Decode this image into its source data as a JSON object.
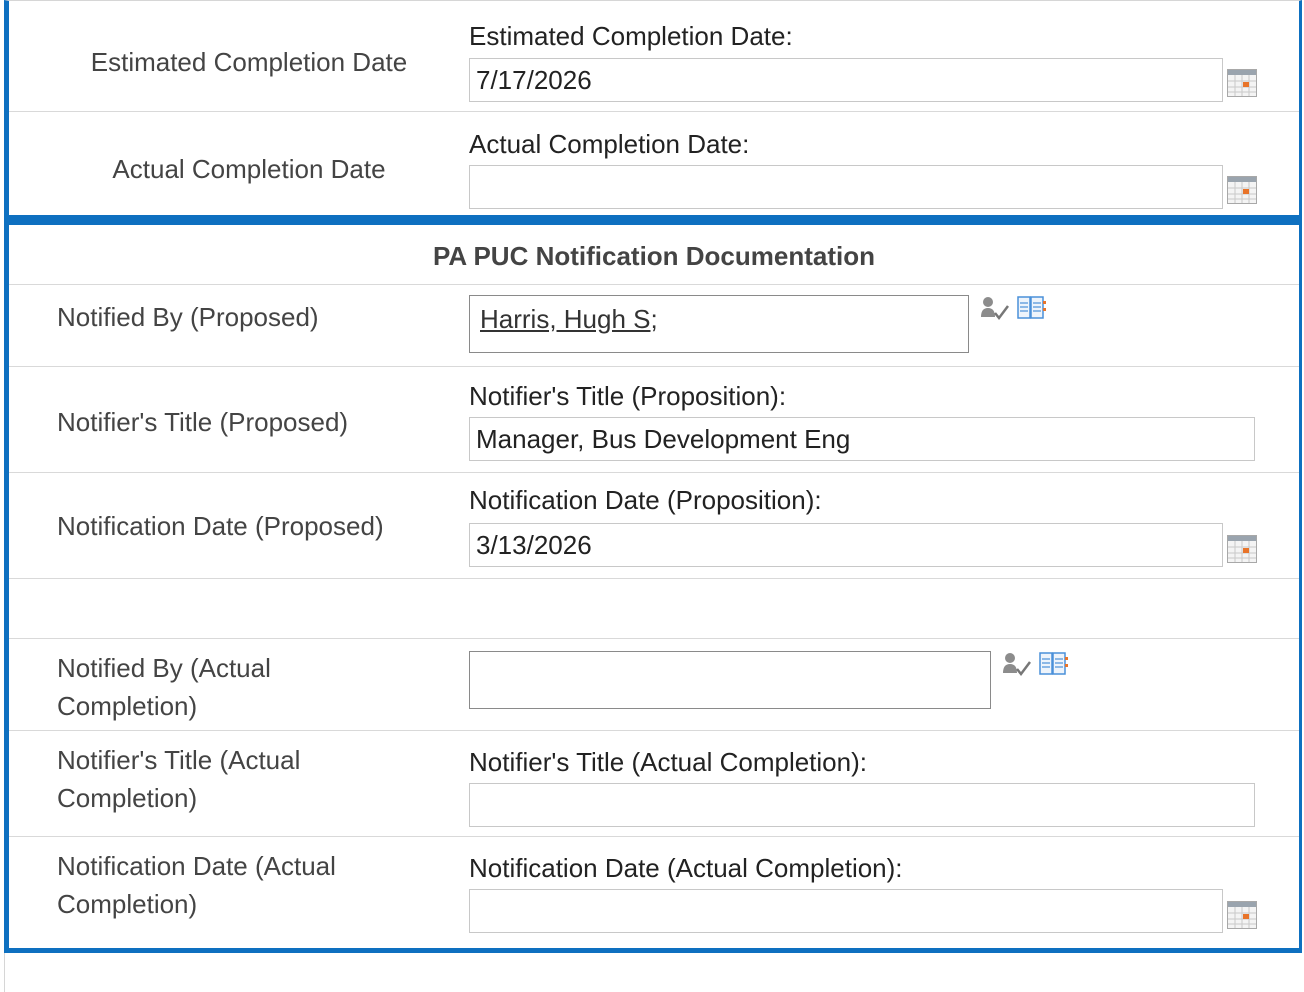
{
  "estimated": {
    "row_label": "Estimated Completion Date",
    "field_label": "Estimated Completion Date:",
    "value": "7/17/2026"
  },
  "actual": {
    "row_label": "Actual Completion Date",
    "field_label": "Actual Completion Date:",
    "value": ""
  },
  "pa_puc": {
    "section_title": "PA PUC Notification Documentation",
    "notified_by_proposed": {
      "row_label": "Notified By (Proposed)",
      "person": "Harris, Hugh S",
      "separator": ";"
    },
    "notifier_title_proposed": {
      "row_label": "Notifier's Title (Proposed)",
      "field_label": "Notifier's Title (Proposition):",
      "value": "Manager, Bus Development Eng"
    },
    "notification_date_proposed": {
      "row_label": "Notification Date (Proposed)",
      "field_label": "Notification Date (Proposition):",
      "value": "3/13/2026"
    },
    "notified_by_actual": {
      "row_label_line1": "Notified By (Actual",
      "row_label_line2": "Completion)",
      "value": ""
    },
    "notifier_title_actual": {
      "row_label_line1": "Notifier's Title (Actual",
      "row_label_line2": "Completion)",
      "field_label": "Notifier's Title (Actual Completion):",
      "value": ""
    },
    "notification_date_actual": {
      "row_label_line1": "Notification Date (Actual",
      "row_label_line2": "Completion)",
      "field_label": "Notification Date (Actual Completion):",
      "value": ""
    }
  },
  "icons": {
    "calendar": "calendar-icon",
    "check_names": "check-names-icon",
    "browse": "address-book-icon"
  },
  "colors": {
    "accent_border": "#0e70c0"
  }
}
